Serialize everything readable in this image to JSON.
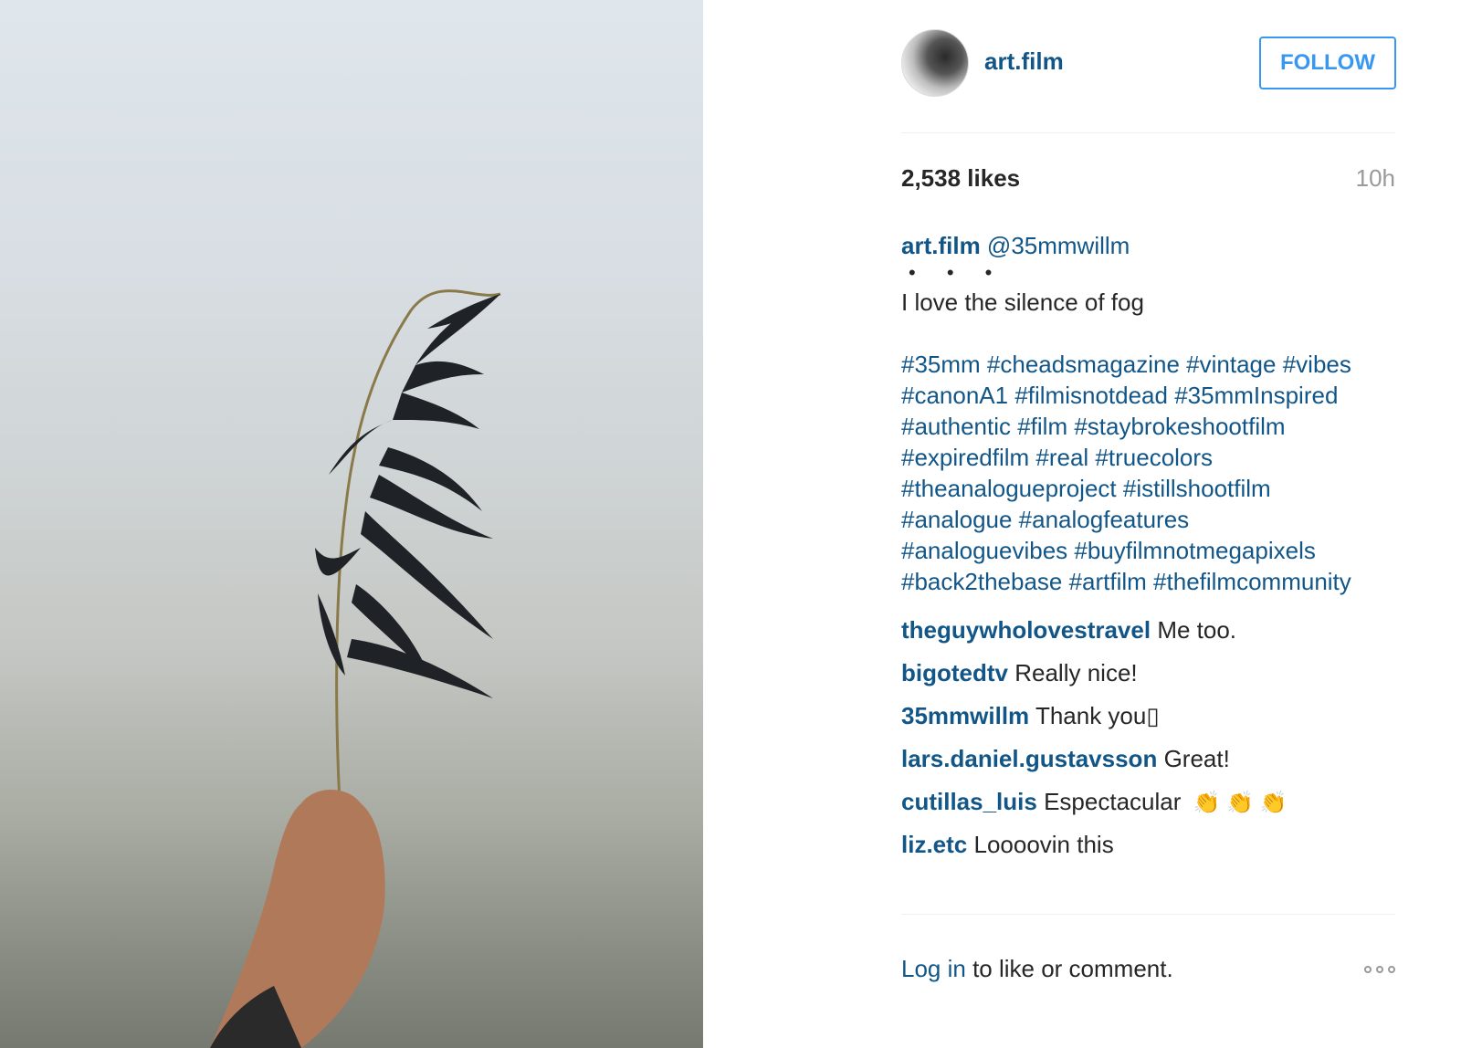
{
  "post": {
    "username": "art.film",
    "follow_label": "FOLLOW",
    "likes": "2,538 likes",
    "time": "10h",
    "caption": {
      "author": "art.film",
      "mention": "@35mmwillm",
      "dots": "• • •",
      "text": "I love the silence of fog",
      "hashtag_lines": [
        "#35mm #cheadsmagazine #vintage #vibes",
        "#canonA1 #filmisnotdead #35mmInspired",
        "#authentic #film #staybrokeshootfilm",
        "#expiredfilm #real #truecolors",
        "#theanalogueproject #istillshootfilm",
        "#analogue #analogfeatures",
        "#analoguevibes #buyfilmnotmegapixels",
        "#back2thebase #artfilm #thefilmcommunity"
      ]
    },
    "comments": [
      {
        "user": "theguywholovestravel",
        "text": "Me too."
      },
      {
        "user": "bigotedtv",
        "text": "Really nice!"
      },
      {
        "user": "35mmwillm",
        "text": "Thank you▯"
      },
      {
        "user": "lars.daniel.gustavsson",
        "text": "Great!"
      },
      {
        "user": "cutillas_luis",
        "text": "Espectacular",
        "emoji": "👏 👏 👏"
      },
      {
        "user": "liz.etc",
        "text": "Loooovin this"
      }
    ],
    "footer": {
      "login_link": "Log in",
      "login_text": " to like or comment.",
      "more_icon": "more-options-icon"
    },
    "colors": {
      "link": "#125688",
      "follow": "#3897f0",
      "muted": "#999999"
    }
  }
}
